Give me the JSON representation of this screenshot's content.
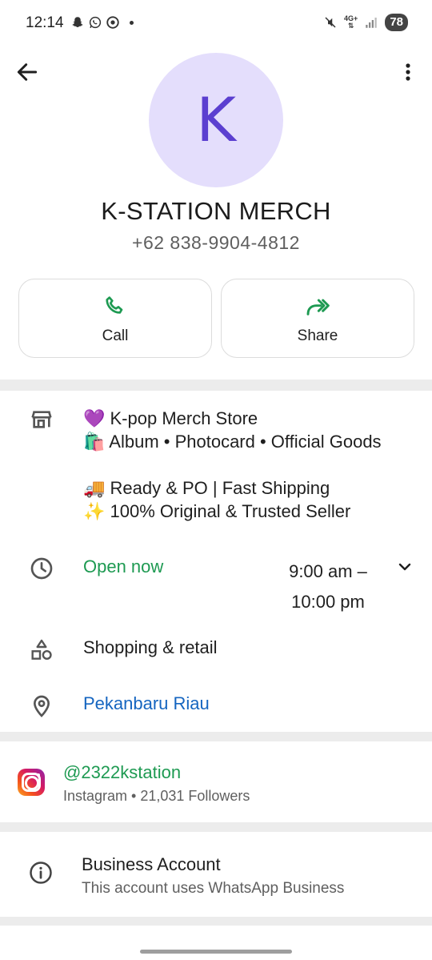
{
  "status_bar": {
    "time": "12:14",
    "left_icons": [
      "snapchat-icon",
      "whatsapp-icon",
      "chrome-icon"
    ],
    "network": "4G+",
    "battery": "78"
  },
  "contact": {
    "avatar_letter": "K",
    "name": "K-STATION MERCH",
    "phone": "+62 838-9904-4812"
  },
  "actions": {
    "call_label": "Call",
    "share_label": "Share"
  },
  "about": {
    "description": "💜 K-pop Merch Store\n🛍️ Album • Photocard • Official Goods\n\n🚚 Ready & PO | Fast Shipping\n✨ 100% Original & Trusted Seller",
    "open_status": "Open now",
    "hours": "9:00 am –\n10:00 pm",
    "category": "Shopping & retail",
    "location": "Pekanbaru Riau"
  },
  "instagram": {
    "handle": "@2322kstation",
    "subtitle": "Instagram • 21,031 Followers"
  },
  "business": {
    "title": "Business Account",
    "subtitle": "This account uses WhatsApp Business"
  },
  "colors": {
    "accent_green": "#1e9a52",
    "link_blue": "#1565c0",
    "avatar_bg": "#e4defc",
    "avatar_fg": "#5b3fd0"
  }
}
